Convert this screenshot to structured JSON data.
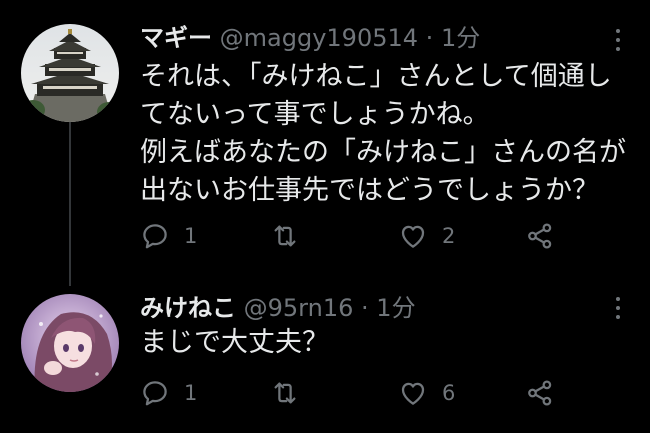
{
  "colors": {
    "background": "#000000",
    "text_primary": "#e7e9ea",
    "text_secondary": "#71767b",
    "thread_line": "#333639"
  },
  "tweets": [
    {
      "display_name": "マギー",
      "handle": "@maggy190514",
      "separator": "·",
      "time": "1分",
      "text": "それは、「みけねこ」さんとして個通してないって事でしょうかね。\n例えばあなたの「みけねこ」さんの名が出ないお仕事先ではどうでしょうか？",
      "replies": "1",
      "retweets": "",
      "likes": "2",
      "avatar": "castle-avatar"
    },
    {
      "display_name": "みけねこ",
      "handle": "@95rn16",
      "separator": "·",
      "time": "1分",
      "text": "まじで大丈夫？",
      "replies": "1",
      "retweets": "",
      "likes": "6",
      "avatar": "anime-girl-avatar"
    }
  ],
  "icons": {
    "reply": "reply-icon",
    "retweet": "retweet-icon",
    "like": "heart-icon",
    "share": "share-icon",
    "more": "more-options-icon"
  }
}
